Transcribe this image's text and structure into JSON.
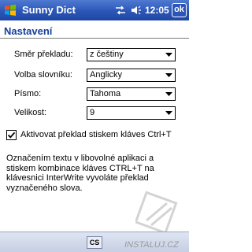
{
  "titlebar": {
    "app_title": "Sunny Dict",
    "clock": "12:05",
    "ok_label": "ok"
  },
  "page": {
    "heading": "Nastavení"
  },
  "form": {
    "direction": {
      "label": "Směr překladu:",
      "value": "z češtiny"
    },
    "dictionary": {
      "label": "Volba slovníku:",
      "value": "Anglicky"
    },
    "font": {
      "label": "Písmo:",
      "value": "Tahoma"
    },
    "size": {
      "label": "Velikost:",
      "value": "9"
    },
    "activate": {
      "label": "Aktivovat překlad stiskem kláves Ctrl+T",
      "checked": true
    },
    "description": "Označením textu v libovolné aplikaci a stiskem kombinace kláves CTRL+T na klávesnici InterWrite vyvoláte překlad vyznačeného slova."
  },
  "menubar": {
    "input_label": "CS"
  },
  "watermark": {
    "text": "INSTALUJ.CZ"
  }
}
